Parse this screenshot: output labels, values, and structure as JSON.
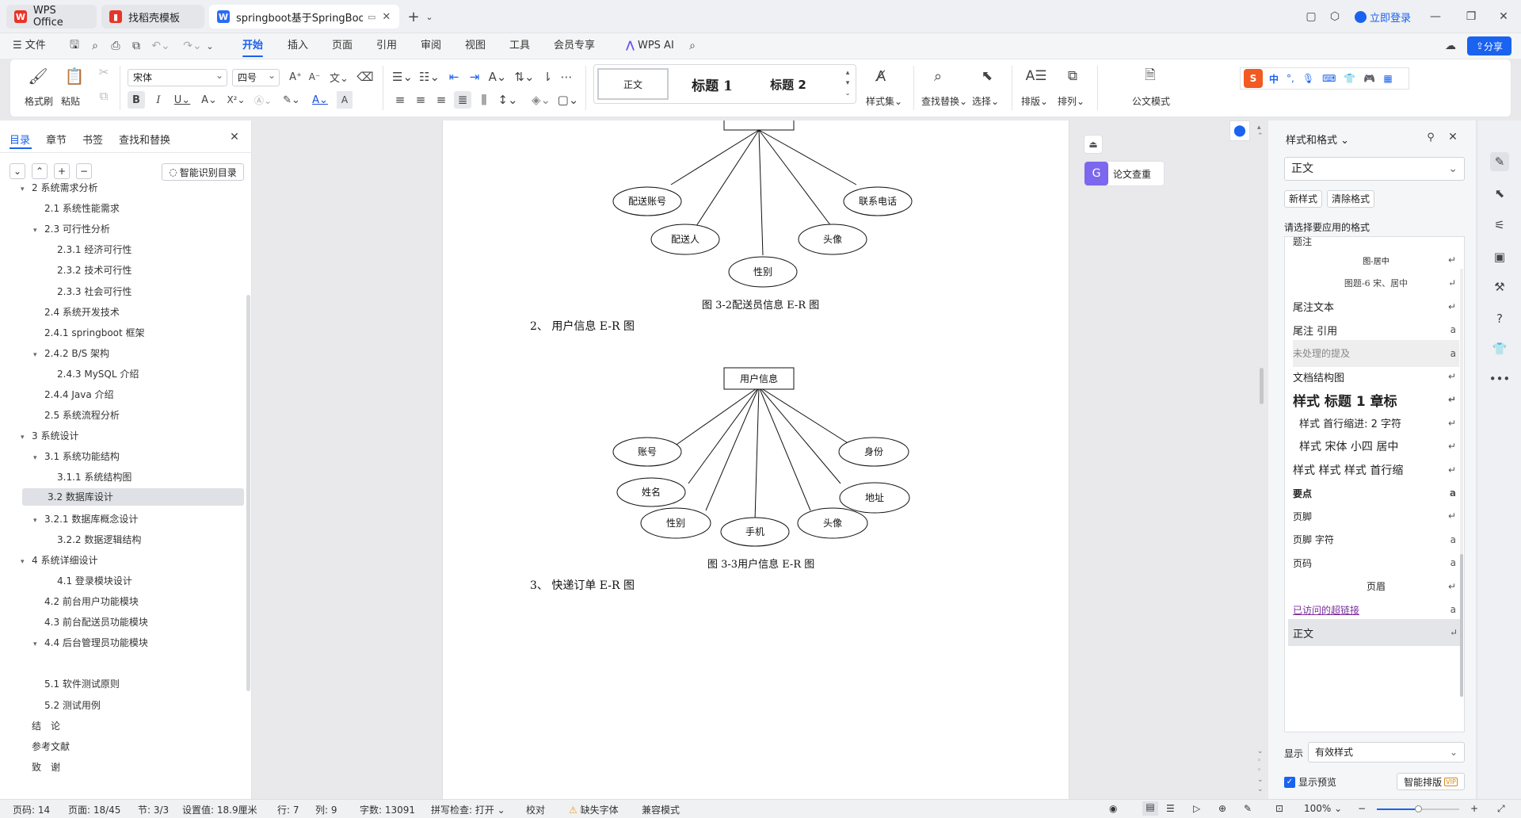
{
  "tabs": [
    {
      "label": "WPS Office"
    },
    {
      "label": "找稻壳模板"
    },
    {
      "label": "springboot基于SpringBoot"
    }
  ],
  "titlebar": {
    "login": "立即登录"
  },
  "menu": {
    "file": "文件",
    "items": [
      "开始",
      "插入",
      "页面",
      "引用",
      "审阅",
      "视图",
      "工具",
      "会员专享"
    ],
    "wps_ai": "WPS AI",
    "share": "分享"
  },
  "ribbon": {
    "format_painter": "格式刷",
    "paste": "粘贴",
    "font_name": "宋体",
    "font_size": "四号",
    "style_normal": "正文",
    "style_h1": "标题 1",
    "style_h2": "标题 2",
    "style_set": "样式集",
    "find_replace": "查找替换",
    "select": "选择",
    "layout": "排版",
    "arrange": "排列",
    "official": "公文模式",
    "ime": "中"
  },
  "left": {
    "tabs": [
      "目录",
      "章节",
      "书签",
      "查找和替换"
    ],
    "smart_toc": "智能识别目录",
    "toc": [
      {
        "t": "2 系统需求分析",
        "lvl": 1,
        "arr": "▾"
      },
      {
        "t": "2.1 系统性能需求",
        "lvl": 2,
        "arr": ""
      },
      {
        "t": "2.3 可行性分析",
        "lvl": 2,
        "arr": "▾"
      },
      {
        "t": "2.3.1 经济可行性",
        "lvl": 3,
        "arr": ""
      },
      {
        "t": "2.3.2 技术可行性",
        "lvl": 3,
        "arr": ""
      },
      {
        "t": "2.3.3 社会可行性",
        "lvl": 3,
        "arr": ""
      },
      {
        "t": "2.4 系统开发技术",
        "lvl": 2,
        "arr": ""
      },
      {
        "t": "2.4.1    springboot 框架",
        "lvl": 2,
        "arr": ""
      },
      {
        "t": "2.4.2    B/S 架构",
        "lvl": 2,
        "arr": "▾"
      },
      {
        "t": "2.4.3 MySQL 介绍",
        "lvl": 3,
        "arr": ""
      },
      {
        "t": "2.4.4 Java 介绍",
        "lvl": 2,
        "arr": ""
      },
      {
        "t": "2.5 系统流程分析",
        "lvl": 2,
        "arr": ""
      },
      {
        "t": "3 系统设计",
        "lvl": 1,
        "arr": "▾"
      },
      {
        "t": "3.1 系统功能结构",
        "lvl": 2,
        "arr": "▾"
      },
      {
        "t": "3.1.1 系统结构图",
        "lvl": 3,
        "arr": ""
      },
      {
        "t": "3.2 数据库设计",
        "lvl": 2,
        "arr": "",
        "sel": true
      },
      {
        "t": "3.2.1  数据库概念设计",
        "lvl": 2,
        "arr": "▾"
      },
      {
        "t": "3.2.2 数据逻辑结构",
        "lvl": 3,
        "arr": ""
      },
      {
        "t": "4 系统详细设计",
        "lvl": 1,
        "arr": "▾"
      },
      {
        "t": "4.1 登录模块设计",
        "lvl": 3,
        "arr": ""
      },
      {
        "t": "4.2  前台用户功能模块",
        "lvl": 2,
        "arr": ""
      },
      {
        "t": "4.3 前台配送员功能模块",
        "lvl": 2,
        "arr": ""
      },
      {
        "t": "4.4 后台管理员功能模块",
        "lvl": 2,
        "arr": "▾"
      },
      {
        "t": "",
        "lvl": 2,
        "arr": ""
      },
      {
        "t": "5.1 软件测试原则",
        "lvl": 2,
        "arr": ""
      },
      {
        "t": "5.2 测试用例",
        "lvl": 2,
        "arr": ""
      },
      {
        "t": "结　论",
        "lvl": 1,
        "arr": ""
      },
      {
        "t": "参考文献",
        "lvl": 1,
        "arr": ""
      },
      {
        "t": "致　谢",
        "lvl": 1,
        "arr": ""
      }
    ]
  },
  "doc": {
    "er1": {
      "attrs": [
        "配送账号",
        "配送人",
        "性别",
        "头像",
        "联系电话"
      ]
    },
    "cap1": "图 3-2配送员信息 E-R 图",
    "p2": "2、  用户信息 E-R 图",
    "er2": {
      "entity": "用户信息",
      "attrs": [
        "账号",
        "姓名",
        "性别",
        "手机",
        "头像",
        "地址",
        "身份"
      ]
    },
    "cap2": "图 3-3用户信息 E-R 图",
    "p3": "3、  快递订单 E-R 图"
  },
  "float": {
    "check": "论文查重"
  },
  "right": {
    "title": "样式和格式",
    "current": "正文",
    "new_style": "新样式",
    "clear": "清除格式",
    "hint": "请选择要应用的格式",
    "styles": [
      {
        "t": "题注",
        "mk": ""
      },
      {
        "t": "图-居中",
        "mk": "↵"
      },
      {
        "t": "图题-6 宋、居中",
        "mk": "↵"
      },
      {
        "t": "尾注文本",
        "mk": "↵"
      },
      {
        "t": "尾注 引用",
        "mk": "a"
      },
      {
        "t": "未处理的提及",
        "mk": "a"
      },
      {
        "t": "文档结构图",
        "mk": "↵"
      },
      {
        "t": "样式 标题 1 章标",
        "mk": "↵"
      },
      {
        "t": "样式 首行缩进: 2 字符",
        "mk": "↵"
      },
      {
        "t": "样式 宋体 小四 居中",
        "mk": "↵"
      },
      {
        "t": "样式 样式 样式 首行缩",
        "mk": "↵"
      },
      {
        "t": "要点",
        "mk": "a"
      },
      {
        "t": "页脚",
        "mk": "↵"
      },
      {
        "t": "页脚 字符",
        "mk": "a"
      },
      {
        "t": "页码",
        "mk": "a"
      },
      {
        "t": "页眉",
        "mk": "↵"
      },
      {
        "t": "已访问的超链接",
        "mk": "a"
      },
      {
        "t": "正文",
        "mk": "↵"
      }
    ],
    "show_label": "显示",
    "show_value": "有效样式",
    "preview": "显示预览",
    "smart_layout": "智能排版",
    "vip": "VIP"
  },
  "status": {
    "page": "页码: 14",
    "pages": "页面: 18/45",
    "section": "节: 3/3",
    "setting": "设置值: 18.9厘米",
    "row": "行: 7",
    "col": "列: 9",
    "words": "字数: 13091",
    "spell": "拼写检查: 打开",
    "proof": "校对",
    "missing_font": "缺失字体",
    "compat": "兼容模式",
    "zoom": "100%"
  }
}
